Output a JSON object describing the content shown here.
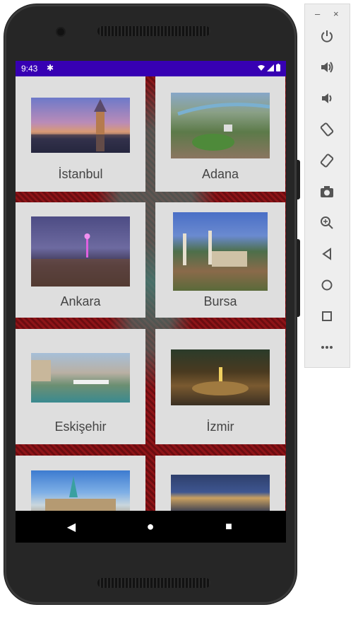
{
  "status_bar": {
    "time": "9:43",
    "bg": "#3700b3"
  },
  "cities": [
    {
      "name": "İstanbul"
    },
    {
      "name": "Adana"
    },
    {
      "name": "Ankara"
    },
    {
      "name": "Bursa"
    },
    {
      "name": "Eskişehir"
    },
    {
      "name": "İzmir"
    },
    {
      "name": ""
    },
    {
      "name": ""
    }
  ],
  "toolbar": {
    "minimize": "–",
    "close": "×",
    "buttons": [
      "power-icon",
      "volume-up-icon",
      "volume-down-icon",
      "rotate-left-icon",
      "rotate-right-icon",
      "camera-icon",
      "zoom-icon",
      "back-icon",
      "home-icon",
      "overview-icon",
      "more-icon"
    ]
  },
  "nav": {
    "back": "◀",
    "home": "●",
    "recent": "■"
  },
  "colors": {
    "card_bg": "#dedede",
    "label": "#444444",
    "status": "#3700b3"
  }
}
